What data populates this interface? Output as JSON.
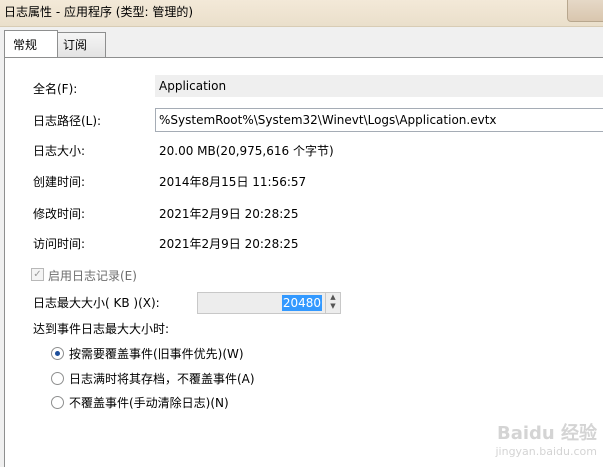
{
  "window": {
    "title": "日志属性 - 应用程序 (类型: 管理的)"
  },
  "tabs": [
    {
      "label": "常规",
      "active": true
    },
    {
      "label": "订阅",
      "active": false
    }
  ],
  "general": {
    "full_name_label": "全名(F):",
    "full_name_value": "Application",
    "log_path_label": "日志路径(L):",
    "log_path_value": "%SystemRoot%\\System32\\Winevt\\Logs\\Application.evtx",
    "log_size_label": "日志大小:",
    "log_size_value": "20.00 MB(20,975,616 个字节)",
    "created_label": "创建时间:",
    "created_value": "2014年8月15日 11:56:57",
    "modified_label": "修改时间:",
    "modified_value": "2021年2月9日 20:28:25",
    "accessed_label": "访问时间:",
    "accessed_value": "2021年2月9日 20:28:25",
    "enable_logging_label": "启用日志记录(E)",
    "enable_logging_checked": true,
    "max_size_label": "日志最大大小( KB )(X):",
    "max_size_value": "20480",
    "when_max_label": "达到事件日志最大大小时:",
    "options": [
      {
        "label": "按需要覆盖事件(旧事件优先)(W)",
        "checked": true
      },
      {
        "label": "日志满时将其存档，不覆盖事件(A)",
        "checked": false
      },
      {
        "label": "不覆盖事件(手动清除日志)(N)",
        "checked": false
      }
    ]
  },
  "icons": {
    "check": "checkmark-icon",
    "spin_up": "arrow-up-icon",
    "spin_down": "arrow-down-icon"
  },
  "watermark": {
    "brand": "Baidu 经验",
    "url": "jingyan.baidu.com"
  }
}
